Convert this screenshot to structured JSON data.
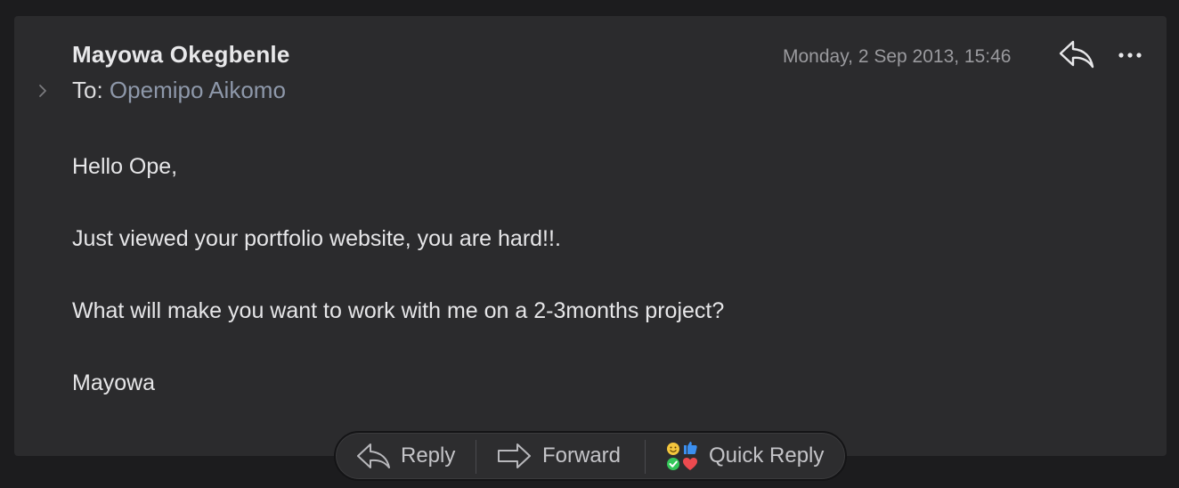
{
  "message": {
    "sender": "Mayowa Okegbenle",
    "to_label": "To:",
    "to_name": "Opemipo Aikomo",
    "date": "Monday, 2 Sep 2013, 15:46",
    "body": [
      "Hello Ope,",
      "Just viewed your portfolio website, you are hard!!.",
      "What will make you want to work with me on a 2-3months project?",
      "Mayowa"
    ]
  },
  "toolbar": {
    "reply_label": "Reply",
    "forward_label": "Forward",
    "quick_reply_label": "Quick Reply"
  },
  "icons": {
    "expand": "chevron-right-icon",
    "reply_top": "reply-arrow-icon",
    "more": "ellipsis-icon",
    "reply": "reply-arrow-icon",
    "forward": "forward-arrow-icon",
    "quick_reply": "emoji-reactions-icon"
  },
  "colors": {
    "background": "#1c1c1e",
    "card": "#2b2b2d",
    "text": "#e6e6e8",
    "recipient": "#8e98aa",
    "date": "#9a9a9e"
  }
}
